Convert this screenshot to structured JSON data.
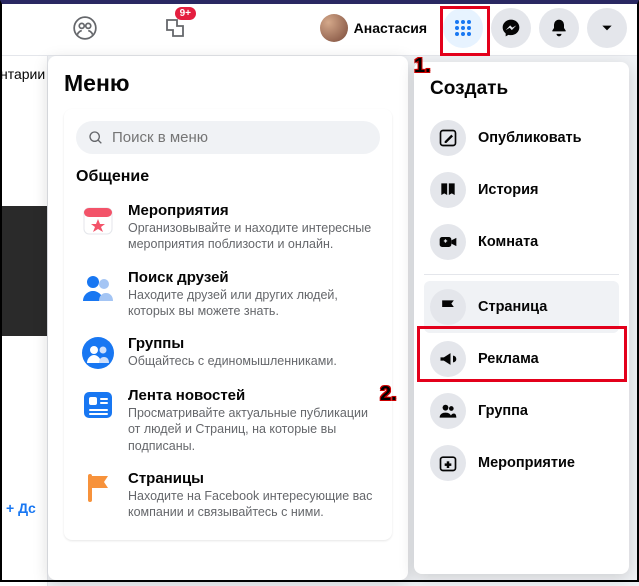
{
  "topbar": {
    "groups_badge": "9+",
    "user_name": "Анастасия"
  },
  "left_strip": {
    "truncated_text": "нтарии",
    "add_label": "Дс"
  },
  "menu": {
    "title": "Меню",
    "search_placeholder": "Поиск в меню",
    "section_header": "Общение",
    "items": [
      {
        "title": "Мероприятия",
        "desc": "Организовывайте и находите интересные мероприятия поблизости и онлайн."
      },
      {
        "title": "Поиск друзей",
        "desc": "Находите друзей или других людей, которых вы можете знать."
      },
      {
        "title": "Группы",
        "desc": "Общайтесь с единомышленниками."
      },
      {
        "title": "Лента новостей",
        "desc": "Просматривайте актуальные публикации от людей и Страниц, на которые вы подписаны."
      },
      {
        "title": "Страницы",
        "desc": "Находите на Facebook интересующие вас компании и связывайтесь с ними."
      }
    ]
  },
  "create": {
    "title": "Создать",
    "items": [
      {
        "label": "Опубликовать"
      },
      {
        "label": "История"
      },
      {
        "label": "Комната"
      },
      {
        "label": "Страница"
      },
      {
        "label": "Реклама"
      },
      {
        "label": "Группа"
      },
      {
        "label": "Мероприятие"
      }
    ]
  },
  "annotations": {
    "one": "1.",
    "two": "2."
  }
}
